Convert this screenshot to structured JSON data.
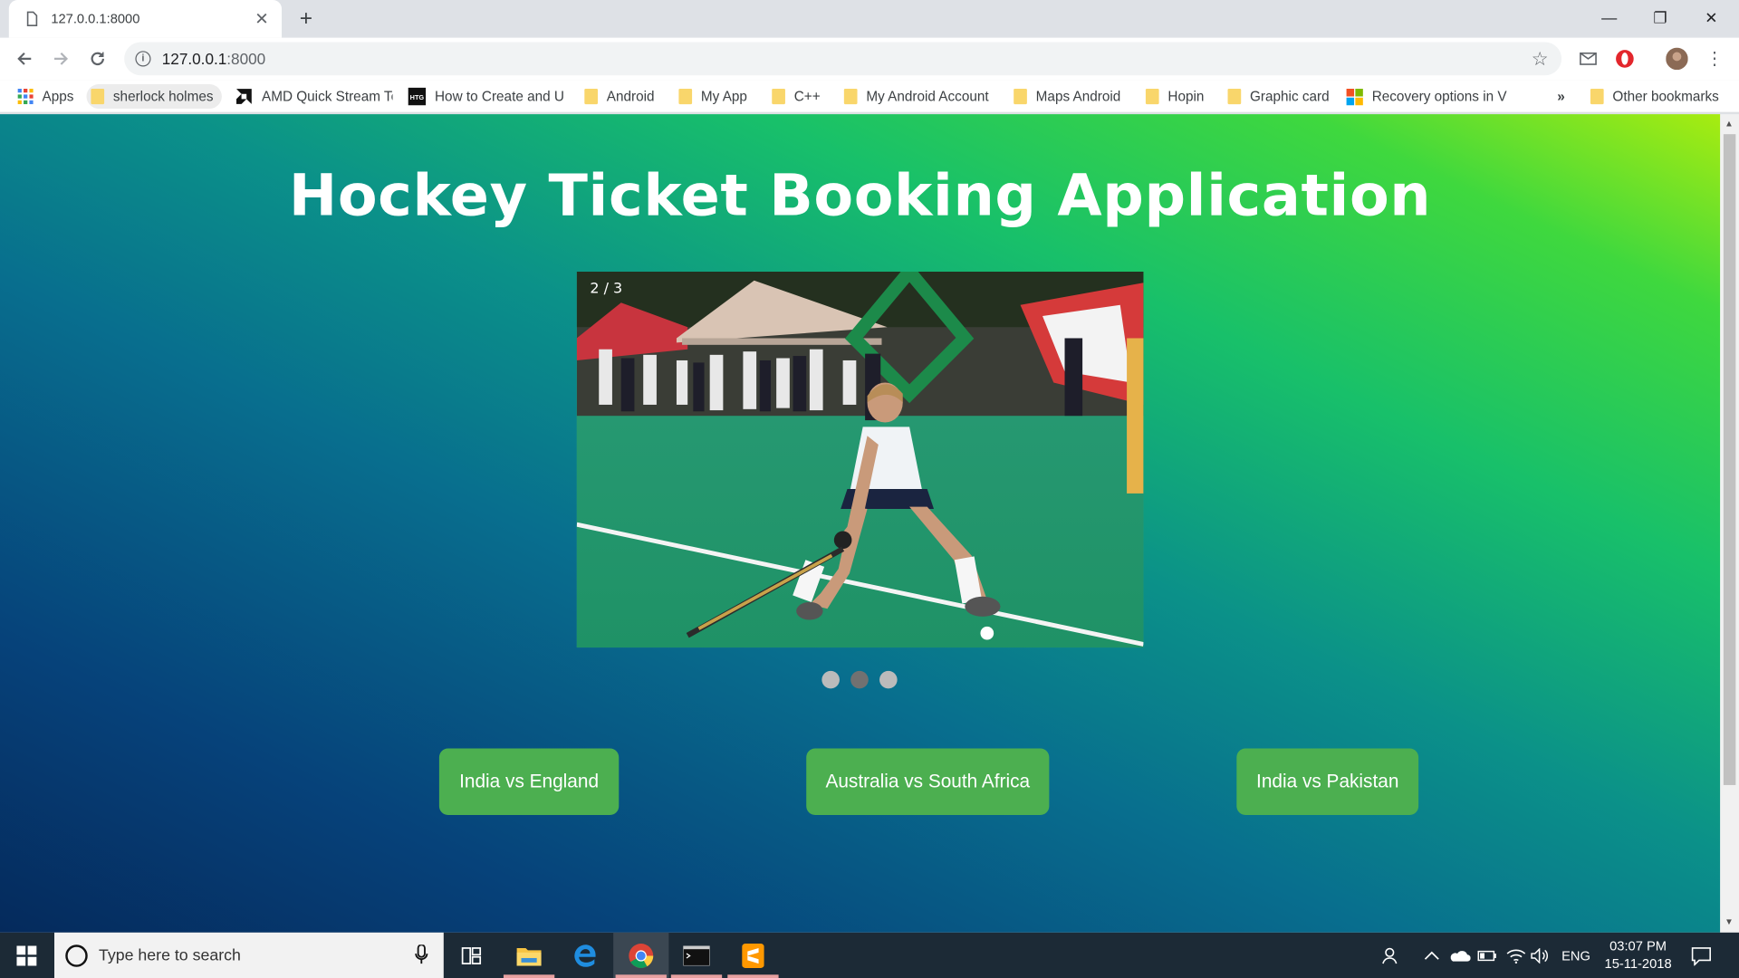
{
  "browser": {
    "tab_title": "127.0.0.1:8000",
    "url_host": "127.0.0.1",
    "url_port": ":8000",
    "bookmarks": [
      {
        "label": "Apps",
        "icon": "apps-grid-icon"
      },
      {
        "label": "sherlock holmes",
        "icon": "folder-icon"
      },
      {
        "label": "AMD Quick Stream Te",
        "icon": "amd-icon"
      },
      {
        "label": "How to Create and U",
        "icon": "htg-icon"
      },
      {
        "label": "Android",
        "icon": "folder-icon"
      },
      {
        "label": "My App",
        "icon": "folder-icon"
      },
      {
        "label": "C++",
        "icon": "folder-icon"
      },
      {
        "label": "My Android Account",
        "icon": "folder-icon"
      },
      {
        "label": "Maps Android",
        "icon": "folder-icon"
      },
      {
        "label": "Hopin",
        "icon": "folder-icon"
      },
      {
        "label": "Graphic card",
        "icon": "folder-icon"
      },
      {
        "label": "Recovery options in V",
        "icon": "windows-logo-icon"
      }
    ],
    "overflow": "»",
    "other_bookmarks": "Other bookmarks"
  },
  "page": {
    "heading": "Hockey Ticket Booking Application",
    "slideshow": {
      "counter": "2 / 3",
      "total_slides": 3,
      "active_slide": 2
    },
    "matches": [
      {
        "label": "India vs England"
      },
      {
        "label": "Australia vs South Africa"
      },
      {
        "label": "India vs Pakistan"
      }
    ],
    "colors": {
      "button": "#4caf50",
      "gradient_start": "#052a5c",
      "gradient_end": "#a8ec10"
    }
  },
  "taskbar": {
    "search_placeholder": "Type here to search",
    "language": "ENG",
    "time": "03:07 PM",
    "date": "15-11-2018"
  }
}
